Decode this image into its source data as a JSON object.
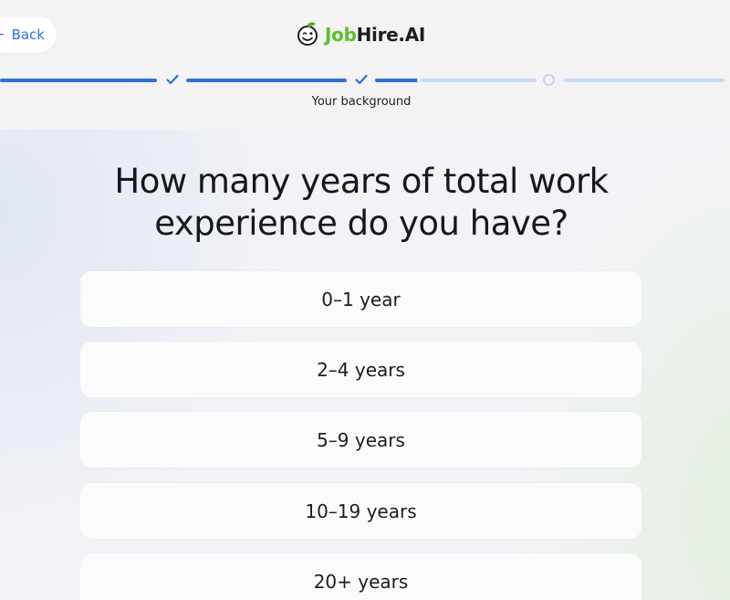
{
  "header": {
    "back_label": "Back",
    "back_icon": "arrow-left-icon",
    "logo": {
      "icon": "smiley-face-icon",
      "text_part1": "Job",
      "text_part2": "Hire.AI",
      "brand_green": "#5cbf2a"
    }
  },
  "progress": {
    "steps_completed": 2,
    "current_step_progress": 0.2,
    "step_label": "Your background",
    "done_color": "#2f6fde",
    "todo_color": "#c9d9f7"
  },
  "question": {
    "text": "How many years of total work experience do you have?"
  },
  "options": [
    {
      "label": "0–1 year"
    },
    {
      "label": "2–4 years"
    },
    {
      "label": "5–9 years"
    },
    {
      "label": "10–19 years"
    },
    {
      "label": "20+ years"
    }
  ]
}
